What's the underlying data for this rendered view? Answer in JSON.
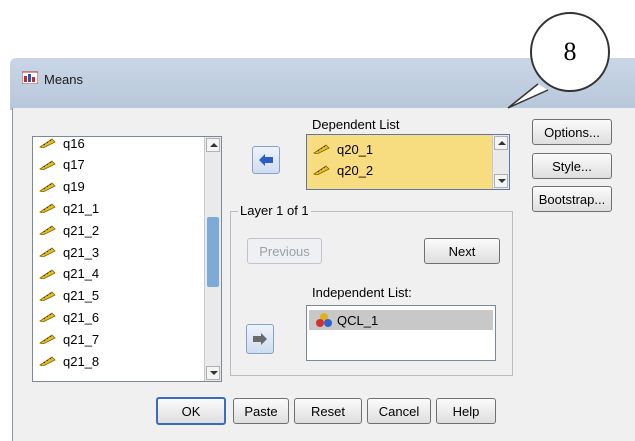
{
  "window": {
    "title": "Means"
  },
  "callout": {
    "number": "8"
  },
  "variables_list": {
    "items": [
      "q16",
      "q17",
      "q19",
      "q21_1",
      "q21_2",
      "q21_3",
      "q21_4",
      "q21_5",
      "q21_6",
      "q21_7",
      "q21_8"
    ]
  },
  "dependent": {
    "label": "Dependent List",
    "items": [
      "q20_1",
      "q20_2"
    ]
  },
  "layer": {
    "label": "Layer 1 of 1",
    "previous": "Previous",
    "next": "Next"
  },
  "independent": {
    "label": "Independent List:",
    "items": [
      "QCL_1"
    ]
  },
  "side_buttons": {
    "options": "Options...",
    "style": "Style...",
    "bootstrap": "Bootstrap..."
  },
  "bottom_buttons": {
    "ok": "OK",
    "paste": "Paste",
    "reset": "Reset",
    "cancel": "Cancel",
    "help": "Help"
  },
  "colors": {
    "dependent_bg": "#f8dc80",
    "selection": "#c8c8c8",
    "accent": "#3a6bbf"
  },
  "icons": {
    "scale_variable": "ruler-pencil-icon",
    "nominal_variable": "three-circles-icon",
    "move_arrow": "arrow-icon"
  }
}
